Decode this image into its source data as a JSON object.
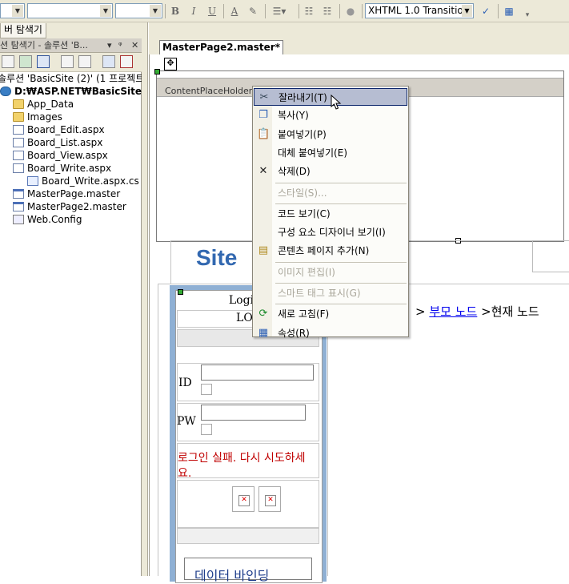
{
  "toolbar": {
    "bold": "B",
    "italic": "I",
    "underline": "U",
    "font_color": "A",
    "doctype_value": "XHTML 1.0 Transitio"
  },
  "left_panel": {
    "tab_label": "버 탐색기",
    "title": "션 탐색기 - 솔루션 'B...",
    "title_controls": [
      "▾",
      "ᵠ",
      "✕"
    ],
    "tree": [
      {
        "label": "솔루션 'BasicSite (2)' (1 프로젝트",
        "icon": "solution-icon",
        "bold": false
      },
      {
        "label": "D:₩ASP.NET₩BasicSite",
        "icon": "project-icon",
        "bold": true
      },
      {
        "label": "App_Data",
        "icon": "folder-icon"
      },
      {
        "label": "Images",
        "icon": "folder-icon"
      },
      {
        "label": "Board_Edit.aspx",
        "icon": "aspx-file-icon"
      },
      {
        "label": "Board_List.aspx",
        "icon": "aspx-file-icon"
      },
      {
        "label": "Board_View.aspx",
        "icon": "aspx-file-icon"
      },
      {
        "label": "Board_Write.aspx",
        "icon": "aspx-file-icon"
      },
      {
        "label": "Board_Write.aspx.cs",
        "icon": "cs-file-icon"
      },
      {
        "label": "MasterPage.master",
        "icon": "master-file-icon"
      },
      {
        "label": "MasterPage2.master",
        "icon": "master-file-icon"
      },
      {
        "label": "Web.Config",
        "icon": "config-file-icon"
      }
    ]
  },
  "document": {
    "tab_label": "MasterPage2.master*",
    "content_placeholder": "ContentPlaceHolder - ContentPlaceHolder1",
    "site_logo": "Site",
    "login": {
      "title": "LoginV",
      "subtitle": "LOG",
      "id_label": "ID",
      "pw_label": "PW",
      "error": "로그인 실패. 다시 시도하세요.",
      "datasource": "데이터 바인딩"
    },
    "breadcrumb": {
      "sep1": ">",
      "parent": "부모 노드",
      "sep2": ">",
      "current": "현재 노드"
    }
  },
  "context_menu": {
    "items": [
      {
        "label": "잘라내기(T)",
        "icon": "scissors-icon",
        "enabled": true,
        "highlighted": true
      },
      {
        "label": "복사(Y)",
        "icon": "copy-icon",
        "enabled": true
      },
      {
        "label": "붙여넣기(P)",
        "icon": "paste-icon",
        "enabled": true
      },
      {
        "label": "대체 붙여넣기(E)",
        "icon": "",
        "enabled": true
      },
      {
        "label": "삭제(D)",
        "icon": "delete-x-icon",
        "enabled": true
      },
      {
        "label": "스타일(S)...",
        "icon": "",
        "enabled": false,
        "sep_before": true
      },
      {
        "label": "코드 보기(C)",
        "icon": "",
        "enabled": true,
        "sep_before": true
      },
      {
        "label": "구성 요소 디자이너 보기(I)",
        "icon": "",
        "enabled": true
      },
      {
        "label": "콘텐츠 페이지 추가(N)",
        "icon": "add-page-icon",
        "enabled": true
      },
      {
        "label": "이미지 편집(I)",
        "icon": "",
        "enabled": false,
        "sep_before": true
      },
      {
        "label": "스마트 태그 표시(G)",
        "icon": "",
        "enabled": false,
        "sep_before": true
      },
      {
        "label": "새로 고침(F)",
        "icon": "refresh-icon",
        "enabled": true,
        "sep_before": true
      },
      {
        "label": "속성(R)",
        "icon": "properties-icon",
        "enabled": true
      }
    ]
  }
}
